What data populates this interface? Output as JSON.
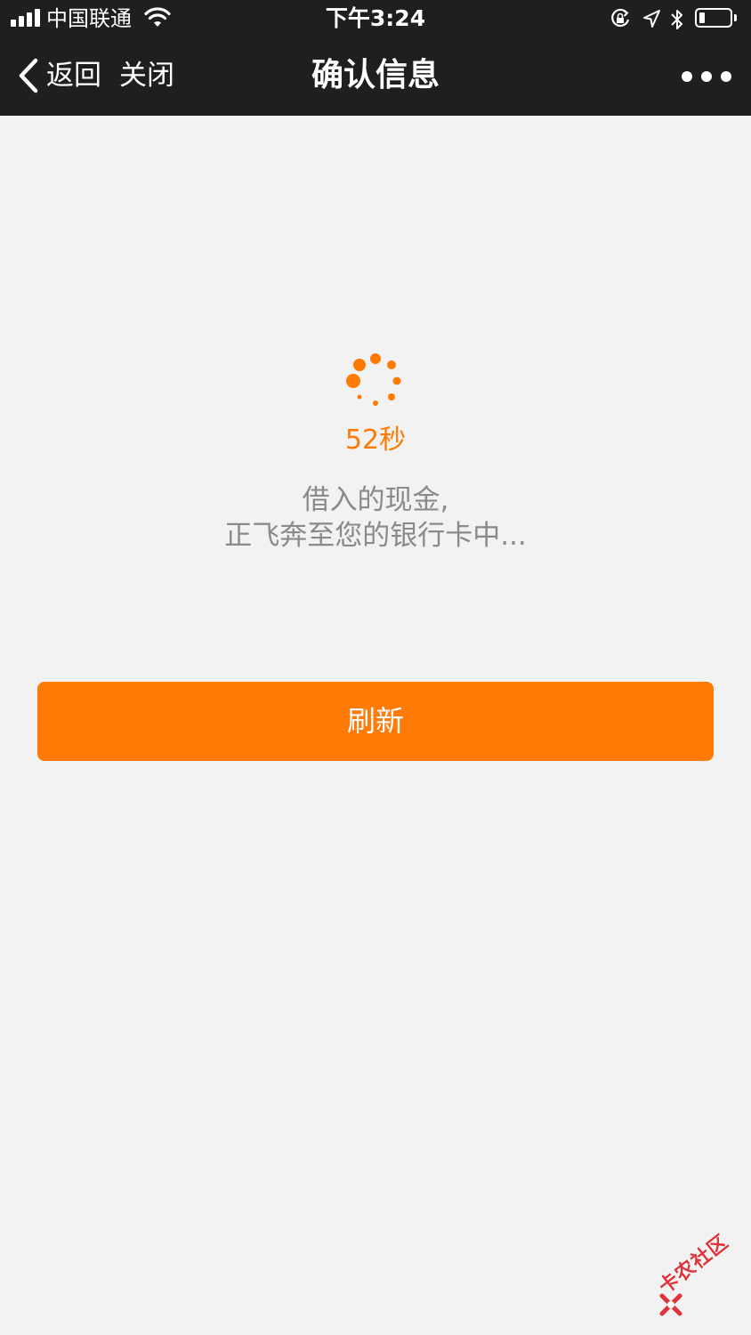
{
  "status_bar": {
    "carrier": "中国联通",
    "time": "下午3:24",
    "battery_level": 0.2,
    "icons": [
      "signal-icon",
      "wifi-icon",
      "orientation-lock-icon",
      "location-icon",
      "bluetooth-icon",
      "battery-icon"
    ]
  },
  "nav": {
    "back_label": "返回",
    "close_label": "关闭",
    "title": "确认信息",
    "more_icon": "more-icon"
  },
  "loading": {
    "countdown": "52秒",
    "message_line1": "借入的现金,",
    "message_line2": "正飞奔至您的银行卡中..."
  },
  "actions": {
    "refresh_label": "刷新"
  },
  "watermark": {
    "text": "卡农社区"
  },
  "colors": {
    "accent": "#ff7a06",
    "nav_background": "#1f1f21",
    "page_background": "#f2f2f2",
    "message_text": "#8a8a8a",
    "watermark": "#e0343a"
  }
}
